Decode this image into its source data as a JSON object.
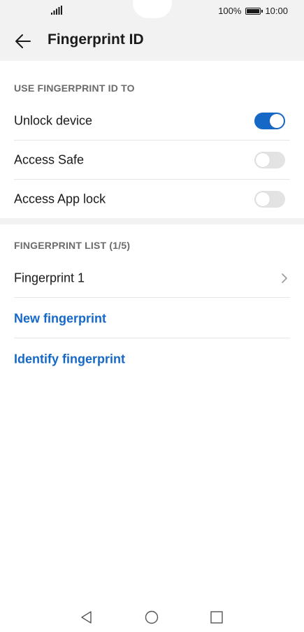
{
  "status_bar": {
    "battery_percent": "100%",
    "time": "10:00"
  },
  "header": {
    "title": "Fingerprint ID"
  },
  "section_use": {
    "heading": "USE FINGERPRINT ID TO",
    "items": [
      {
        "label": "Unlock device",
        "enabled": true
      },
      {
        "label": "Access Safe",
        "enabled": false
      },
      {
        "label": "Access App lock",
        "enabled": false
      }
    ]
  },
  "section_list": {
    "heading": "FINGERPRINT LIST (1/5)",
    "fingerprints": [
      {
        "label": "Fingerprint 1"
      }
    ],
    "new_label": "New fingerprint",
    "identify_label": "Identify fingerprint"
  },
  "colors": {
    "accent": "#1668c7",
    "header_bg": "#f2f2f2"
  },
  "icons": {
    "back": "arrow-left-icon",
    "chevron": "chevron-right-icon",
    "nav_back": "triangle-back-icon",
    "nav_home": "circle-home-icon",
    "nav_recent": "square-recent-icon"
  }
}
